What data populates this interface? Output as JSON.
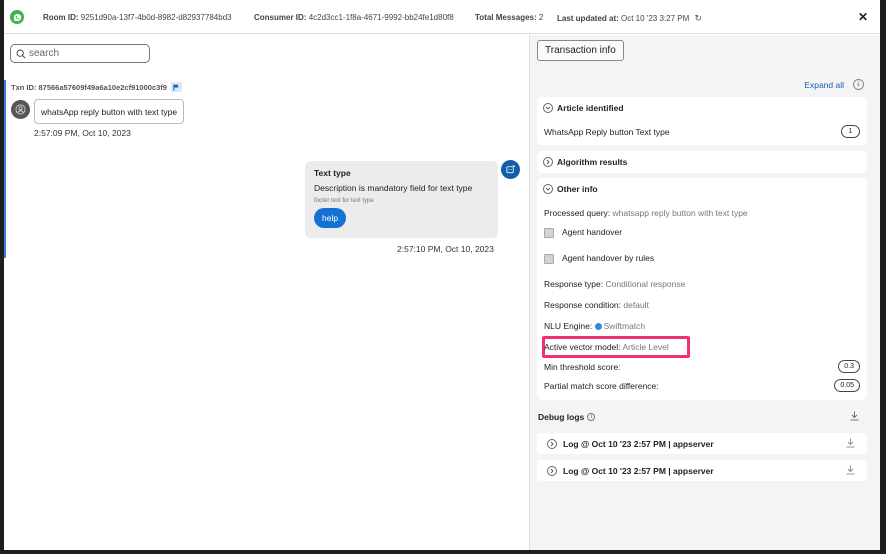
{
  "header": {
    "channel_icon": "whatsapp-icon",
    "room_id_label": "Room ID:",
    "room_id": "9251d90a-13f7-4b0d-8982-d82937784bd3",
    "consumer_id_label": "Consumer ID:",
    "consumer_id": "4c2d3cc1-1f8a-4671-9992-bb24fe1d80f8",
    "total_messages_label": "Total Messages:",
    "total_messages": "2",
    "last_updated_label": "Last updated at:",
    "last_updated": "Oct 10 '23 3:27 PM",
    "refresh_icon": "↻",
    "close_icon": "✕"
  },
  "chat": {
    "search_placeholder": "search",
    "txn_id": "Txn ID: 87566a57609f49a6a10e2cf91000c3f9",
    "user_message": "whatsApp reply button with text type",
    "user_timestamp": "2:57:09 PM, Oct 10, 2023",
    "bot_message": {
      "title": "Text type",
      "description": "Description is mandatory field for text type",
      "footer": "footer text for text type",
      "button_label": "help"
    },
    "bot_timestamp": "2:57:10 PM, Oct 10, 2023"
  },
  "panel": {
    "title_button": "Transaction info",
    "expand_all": "Expand all",
    "article_identified": {
      "title": "Article identified",
      "article_name": "WhatsApp Reply button Text type",
      "count": "1"
    },
    "algorithm_results": {
      "title": "Algorithm results"
    },
    "other_info": {
      "title": "Other info",
      "processed_query_label": "Processed query:",
      "processed_query": "whatsapp reply button with text type",
      "agent_handover_label": "Agent handover",
      "agent_handover_checked": false,
      "agent_handover_rules_label": "Agent handover by rules",
      "agent_handover_rules_checked": false,
      "response_type_label": "Response type:",
      "response_type": "Conditional response",
      "response_condition_label": "Response condition:",
      "response_condition": "default",
      "nlu_engine_label": "NLU Engine:",
      "nlu_engine": "Swiftmatch",
      "active_vector_model_label": "Active vector model:",
      "active_vector_model": "Article Level",
      "min_threshold_label": "Min threshold score:",
      "min_threshold": "0.3",
      "partial_match_label": "Partial match score difference:",
      "partial_match": "0.05"
    },
    "debug_logs": {
      "title": "Debug logs",
      "logs": [
        {
          "label": "Log @ Oct 10 '23 2:57 PM | appserver"
        },
        {
          "label": "Log @ Oct 10 '23 2:57 PM | appserver"
        }
      ]
    }
  },
  "colors": {
    "accent_blue": "#1572d3",
    "highlight": "#f0326a",
    "whatsapp_green": "#3bb54a"
  }
}
